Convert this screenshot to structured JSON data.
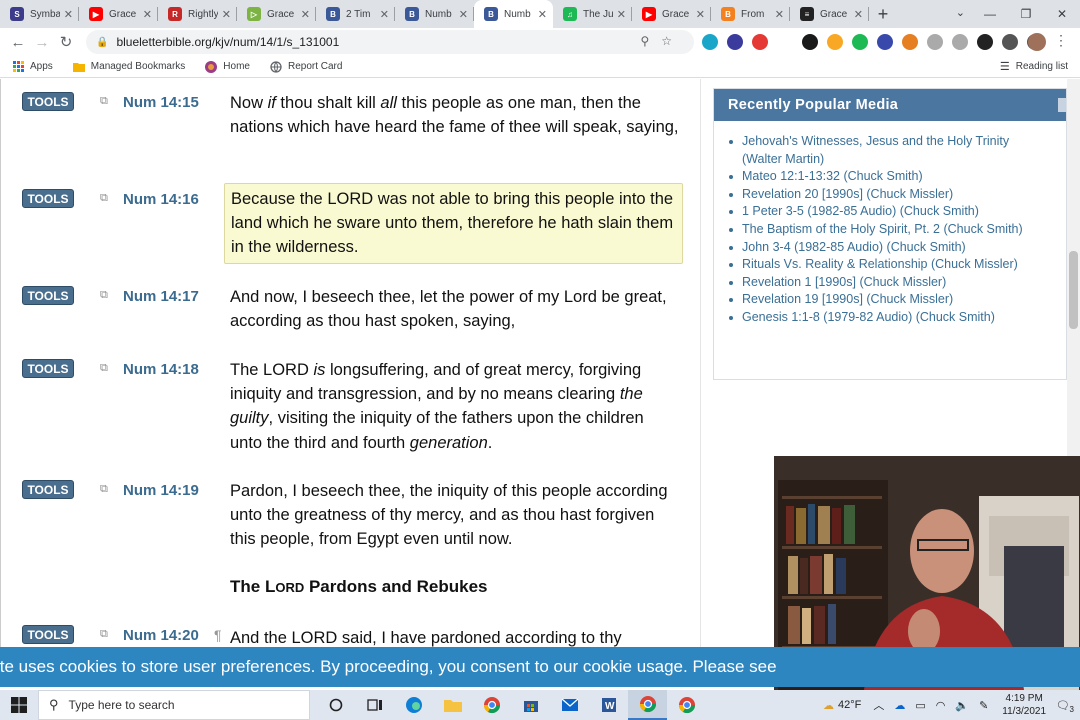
{
  "browser": {
    "tabs": [
      {
        "label": "Symba",
        "color": "#3c3c8a",
        "letter": "S"
      },
      {
        "label": "Grace",
        "color": "#ff0000",
        "letter": "▶"
      },
      {
        "label": "Rightly",
        "color": "#c62828",
        "letter": "R"
      },
      {
        "label": "Grace",
        "color": "#7cb342",
        "letter": "▷"
      },
      {
        "label": "2 Tim",
        "color": "#3b5998",
        "letter": "B"
      },
      {
        "label": "Numb",
        "color": "#3b5998",
        "letter": "B"
      },
      {
        "label": "Numb",
        "color": "#3b5998",
        "letter": "B",
        "active": true
      },
      {
        "label": "The Ju",
        "color": "#1db954",
        "letter": "♫"
      },
      {
        "label": "Grace",
        "color": "#ff0000",
        "letter": "▶"
      },
      {
        "label": "From",
        "color": "#f4811f",
        "letter": "B"
      },
      {
        "label": "Grace",
        "color": "#222222",
        "letter": "≡"
      }
    ],
    "new_tab": "+",
    "url": "blueletterbible.org/kjv/num/14/1/s_131001",
    "bookmarks": [
      {
        "label": "Apps",
        "icon": "apps-grid-icon"
      },
      {
        "label": "Managed Bookmarks",
        "icon": "folder-icon"
      },
      {
        "label": "Home",
        "icon": "home-icon"
      },
      {
        "label": "Report Card",
        "icon": "globe-icon"
      }
    ],
    "reading_list": "Reading list",
    "extension_colors": [
      "#1aa6c9",
      "#3b3b9e",
      "#e53935",
      "#ffffff",
      "#1a1a1a",
      "#f9a825",
      "#1db954",
      "#3949ab",
      "#e67e22",
      "#aaaaaa",
      "#aaaaaa",
      "#222222",
      "#555555",
      "#555555"
    ]
  },
  "verses": [
    {
      "ref": "Num 14:15",
      "tools": "TOOLS",
      "top": 0,
      "html_parts": [
        {
          "t": "Now "
        },
        {
          "t": "if",
          "i": true
        },
        {
          "t": " thou shalt kill "
        },
        {
          "t": "all",
          "i": true
        },
        {
          "t": " this people as one man, then the nations which have heard the fame of thee will speak, saying,"
        }
      ]
    },
    {
      "ref": "Num 14:16",
      "tools": "TOOLS",
      "highlight": true,
      "html_parts": [
        {
          "t": "Because the LORD was not able to bring this people into the land which he sware unto them, therefore he hath slain them in the wilderness."
        }
      ]
    },
    {
      "ref": "Num 14:17",
      "tools": "TOOLS",
      "html_parts": [
        {
          "t": "And now, I beseech thee, let the power of my Lord be great, according as thou hast spoken, saying,"
        }
      ]
    },
    {
      "ref": "Num 14:18",
      "tools": "TOOLS",
      "html_parts": [
        {
          "t": "The LORD "
        },
        {
          "t": "is",
          "i": true
        },
        {
          "t": " longsuffering, and of great mercy, forgiving iniquity and transgression, and by no means clearing "
        },
        {
          "t": "the guilty",
          "i": true
        },
        {
          "t": ", visiting the iniquity of the fathers upon the children unto the third and fourth "
        },
        {
          "t": "generation",
          "i": true
        },
        {
          "t": "."
        }
      ]
    },
    {
      "ref": "Num 14:19",
      "tools": "TOOLS",
      "html_parts": [
        {
          "t": "Pardon, I beseech thee, the iniquity of this people according unto the greatness of thy mercy, and as thou hast forgiven this people, from Egypt even until now."
        }
      ]
    },
    {
      "ref": "Num 14:20",
      "tools": "TOOLS",
      "pilcrow": "¶",
      "html_parts": [
        {
          "t": "And the LORD said, I have pardoned according to thy"
        }
      ]
    }
  ],
  "section_heading": {
    "pre": "The L",
    "small": "ORD",
    "post": " Pardons and Rebukes"
  },
  "sidebar": {
    "title": "Recently Popular Media",
    "items": [
      "Jehovah's Witnesses, Jesus and the Holy Trinity (Walter Martin)",
      "Mateo 12:1-13:32 (Chuck Smith)",
      "Revelation 20 [1990s] (Chuck Missler)",
      "1 Peter 3-5 (1982-85 Audio) (Chuck Smith)",
      "The Baptism of the Holy Spirit, Pt. 2 (Chuck Smith)",
      "John 3-4 (1982-85 Audio) (Chuck Smith)",
      "Rituals Vs. Reality & Relationship (Chuck Missler)",
      "Revelation 1 [1990s] (Chuck Missler)",
      "Revelation 19 [1990s] (Chuck Missler)",
      "Genesis 1:1-8 (1979-82 Audio) (Chuck Smith)"
    ]
  },
  "cookie_banner": "ite uses cookies to store user preferences. By proceeding, you consent to our cookie usage. Please see",
  "taskbar": {
    "search_placeholder": "Type here to search",
    "weather": "42°F",
    "time": "4:19 PM",
    "date": "11/3/2021",
    "notifications": "3"
  }
}
